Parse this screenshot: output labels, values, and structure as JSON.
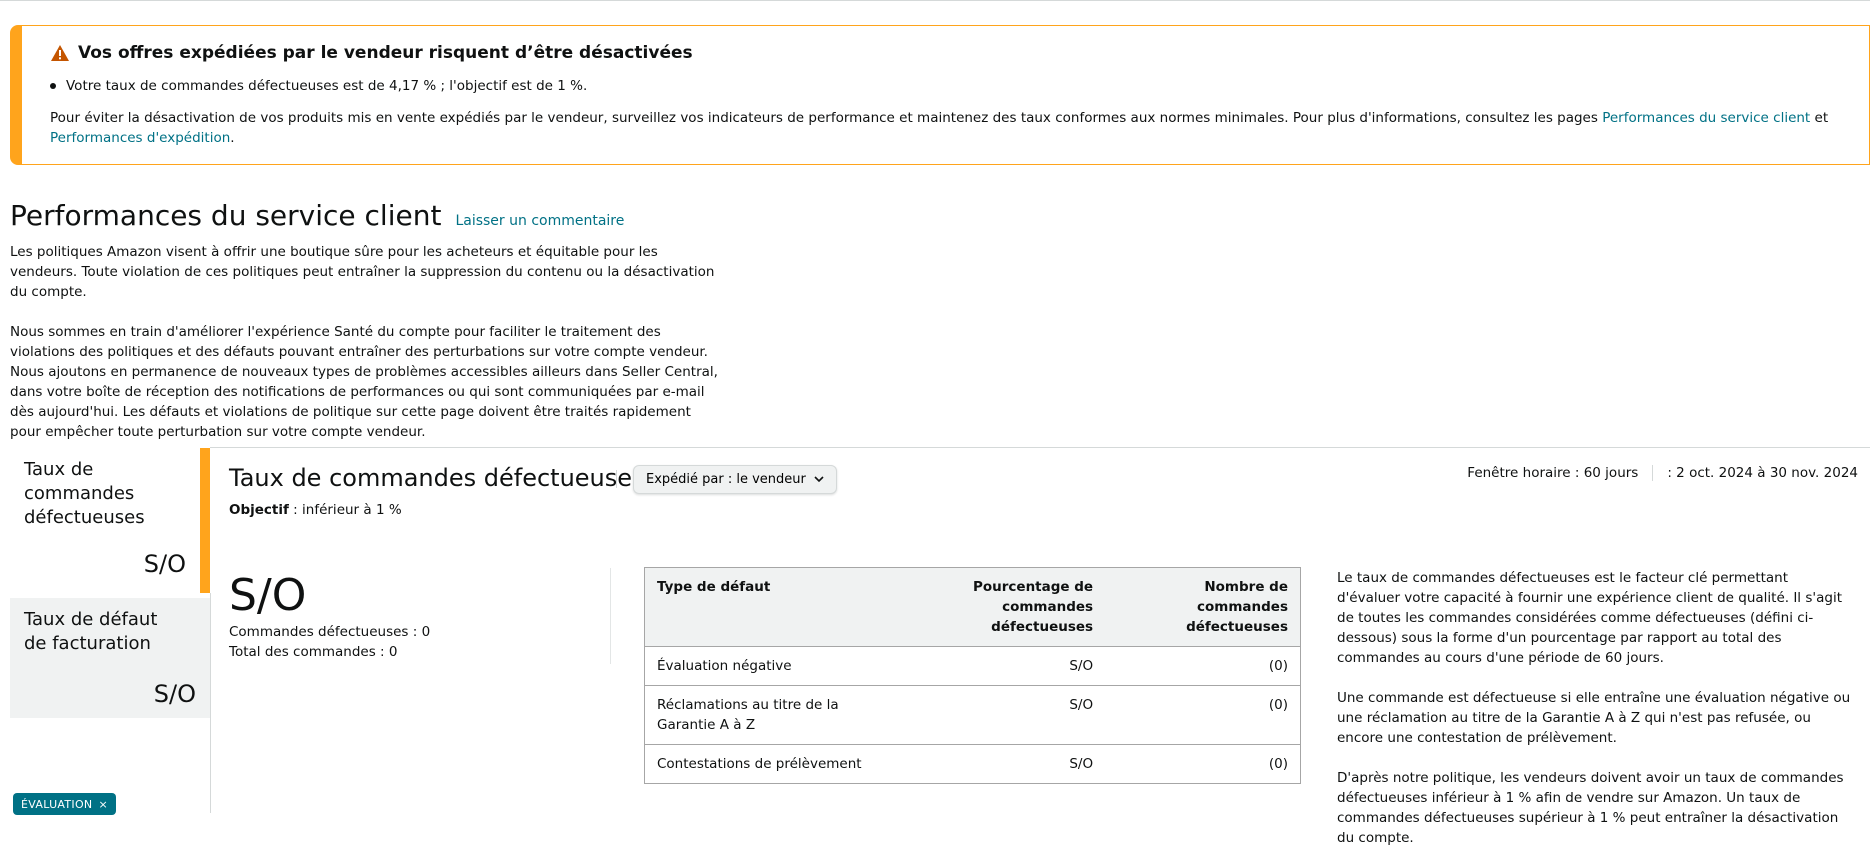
{
  "alert": {
    "title": "Vos offres expédiées par le vendeur risquent d’être désactivées",
    "bullet": "Votre taux de commandes défectueuses est de 4,17 % ; l'objectif est de 1 %.",
    "body_text": "Pour éviter la désactivation de vos produits mis en vente expédiés par le vendeur, surveillez vos indicateurs de performance et maintenez des taux conformes aux normes minimales. Pour plus d'informations, consultez les pages ",
    "link_1": "Performances du service client",
    "connector": " et ",
    "link_2": "Performances d'expédition",
    "end": ".",
    "accent_color": "#ffa41c"
  },
  "page": {
    "title": "Performances du service client",
    "feedback_link": "Laisser un commentaire",
    "intro_1": "Les politiques Amazon visent à offrir une boutique sûre pour les acheteurs et équitable pour les vendeurs. Toute violation de ces politiques peut entraîner la suppression du contenu ou la désactivation du compte.",
    "intro_2": "Nous sommes en train d'améliorer l'expérience Santé du compte pour faciliter le traitement des violations des politiques et des défauts pouvant entraîner des perturbations sur votre compte vendeur. Nous ajoutons en permanence de nouveaux types de problèmes accessibles ailleurs dans Seller Central, dans votre boîte de réception des notifications de performances ou qui sont communiquées par e-mail dès aujourd'hui. Les défauts et violations de politique sur cette page doivent être traités rapidement pour empêcher toute perturbation sur votre compte vendeur."
  },
  "sidebar": {
    "items": [
      {
        "label": "Taux de commandes défectueuses",
        "value": "S/O"
      },
      {
        "label": "Taux de défaut de facturation",
        "value": "S/O"
      }
    ],
    "chip_label": "ÉVALUATION",
    "chip_close": "×"
  },
  "metric": {
    "title": "Taux de commandes défectueuses",
    "dropdown_label": "Expédié par : le vendeur",
    "objective_label": "Objectif",
    "objective_value": " : inférieur à 1 %",
    "window_label": "Fenêtre horaire : 60 jours",
    "window_dates": ": 2 oct. 2024 à 30 nov. 2024",
    "big_value": "S/O",
    "defective_orders": "Commandes défectueuses : 0",
    "total_orders": "Total des commandes : 0"
  },
  "table": {
    "headers": [
      "Type de défaut",
      "Pourcentage de commandes défectueuses",
      "Nombre de commandes défectueuses"
    ],
    "rows": [
      [
        "Évaluation négative",
        "S/O",
        "(0)"
      ],
      [
        "Réclamations au titre de la Garantie A à Z",
        "S/O",
        "(0)"
      ],
      [
        "Contestations de prélèvement",
        "S/O",
        "(0)"
      ]
    ]
  },
  "description": {
    "p1": "Le taux de commandes défectueuses est le facteur clé permettant d'évaluer votre capacité à fournir une expérience client de qualité. Il s'agit de toutes les commandes considérées comme défectueuses (défini ci-dessous) sous la forme d'un pourcentage par rapport au total des commandes au cours d'une période de 60 jours.",
    "p2": "Une commande est défectueuse si elle entraîne une évaluation négative ou une réclamation au titre de la Garantie A à Z qui n'est pas refusée, ou encore une contestation de prélèvement.",
    "p3": "D'après notre politique, les vendeurs doivent avoir un taux de commandes défectueuses inférieur à 1 % afin de vendre sur Amazon. Un taux de commandes défectueuses supérieur à 1 % peut entraîner la désactivation du compte."
  }
}
